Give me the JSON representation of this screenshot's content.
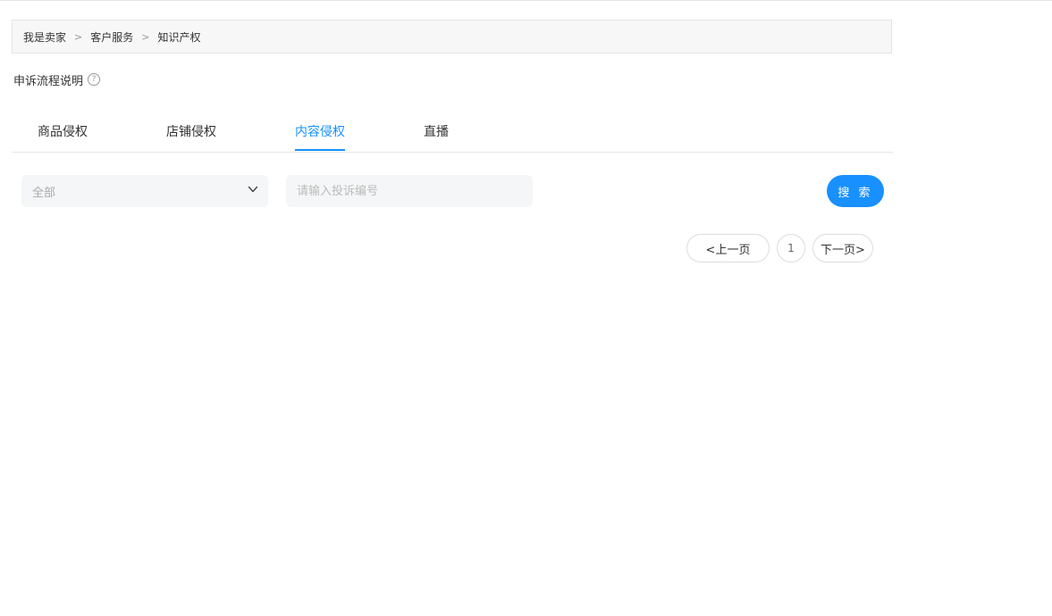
{
  "breadcrumb": {
    "items": [
      "我是卖家",
      "客户服务",
      "知识产权"
    ],
    "separator": ">"
  },
  "appeal": {
    "label": "申诉流程说明",
    "help_icon": "?"
  },
  "tabs": [
    {
      "label": "商品侵权",
      "active": false
    },
    {
      "label": "店铺侵权",
      "active": false
    },
    {
      "label": "内容侵权",
      "active": true
    },
    {
      "label": "直播",
      "active": false
    }
  ],
  "filter": {
    "type_select": {
      "value": "全部",
      "icon": "chevron-down-icon"
    },
    "complaint_input": {
      "placeholder": "请输入投诉编号",
      "value": ""
    },
    "search_label": "搜 索"
  },
  "pagination": {
    "prev_label": "<上一页",
    "current_page": "1",
    "next_label": "下一页>"
  },
  "colors": {
    "accent": "#1890ff",
    "breadcrumb_bg": "#f7f7f7",
    "field_bg": "#f5f6f7"
  }
}
